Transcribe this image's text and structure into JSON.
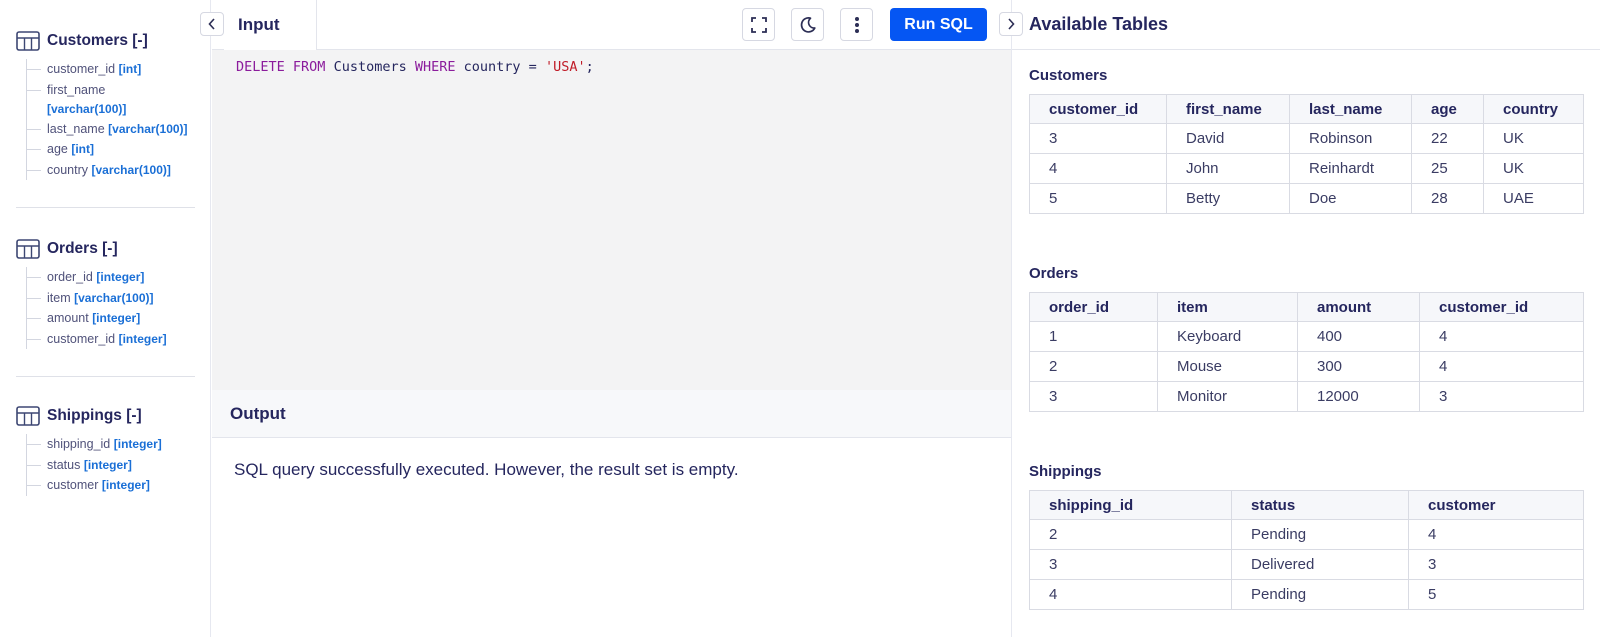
{
  "sidebar": {
    "schemas": [
      {
        "title": "Customers [-]",
        "columns": [
          {
            "name": "customer_id",
            "type": "[int]"
          },
          {
            "name": "first_name",
            "type": "[varchar(100)]"
          },
          {
            "name": "last_name",
            "type": "[varchar(100)]"
          },
          {
            "name": "age",
            "type": "[int]"
          },
          {
            "name": "country",
            "type": "[varchar(100)]"
          }
        ]
      },
      {
        "title": "Orders [-]",
        "columns": [
          {
            "name": "order_id",
            "type": "[integer]"
          },
          {
            "name": "item",
            "type": "[varchar(100)]"
          },
          {
            "name": "amount",
            "type": "[integer]"
          },
          {
            "name": "customer_id",
            "type": "[integer]"
          }
        ]
      },
      {
        "title": "Shippings [-]",
        "columns": [
          {
            "name": "shipping_id",
            "type": "[integer]"
          },
          {
            "name": "status",
            "type": "[integer]"
          },
          {
            "name": "customer",
            "type": "[integer]"
          }
        ]
      }
    ]
  },
  "editor": {
    "tab_label": "Input",
    "run_label": "Run SQL",
    "code": {
      "kw_delete": "DELETE",
      "kw_from": "FROM",
      "table": "Customers",
      "kw_where": "WHERE",
      "condition": "country =",
      "value": "'USA'",
      "terminator": ";"
    },
    "icons": {
      "collapse": "chevron-left-icon",
      "fullscreen": "fullscreen-icon",
      "theme": "moon-icon",
      "more": "more-vertical-icon"
    },
    "accent_color": "#0556f3"
  },
  "output": {
    "title": "Output",
    "message": "SQL query successfully executed. However, the result set is empty."
  },
  "tables_panel": {
    "title": "Available Tables",
    "tables": [
      {
        "title": "Customers",
        "headers": [
          "customer_id",
          "first_name",
          "last_name",
          "age",
          "country"
        ],
        "rows": [
          [
            "3",
            "David",
            "Robinson",
            "22",
            "UK"
          ],
          [
            "4",
            "John",
            "Reinhardt",
            "25",
            "UK"
          ],
          [
            "5",
            "Betty",
            "Doe",
            "28",
            "UAE"
          ]
        ]
      },
      {
        "title": "Orders",
        "headers": [
          "order_id",
          "item",
          "amount",
          "customer_id"
        ],
        "rows": [
          [
            "1",
            "Keyboard",
            "400",
            "4"
          ],
          [
            "2",
            "Mouse",
            "300",
            "4"
          ],
          [
            "3",
            "Monitor",
            "12000",
            "3"
          ]
        ]
      },
      {
        "title": "Shippings",
        "headers": [
          "shipping_id",
          "status",
          "customer"
        ],
        "rows": [
          [
            "2",
            "Pending",
            "4"
          ],
          [
            "3",
            "Delivered",
            "3"
          ],
          [
            "4",
            "Pending",
            "5"
          ]
        ]
      }
    ]
  }
}
